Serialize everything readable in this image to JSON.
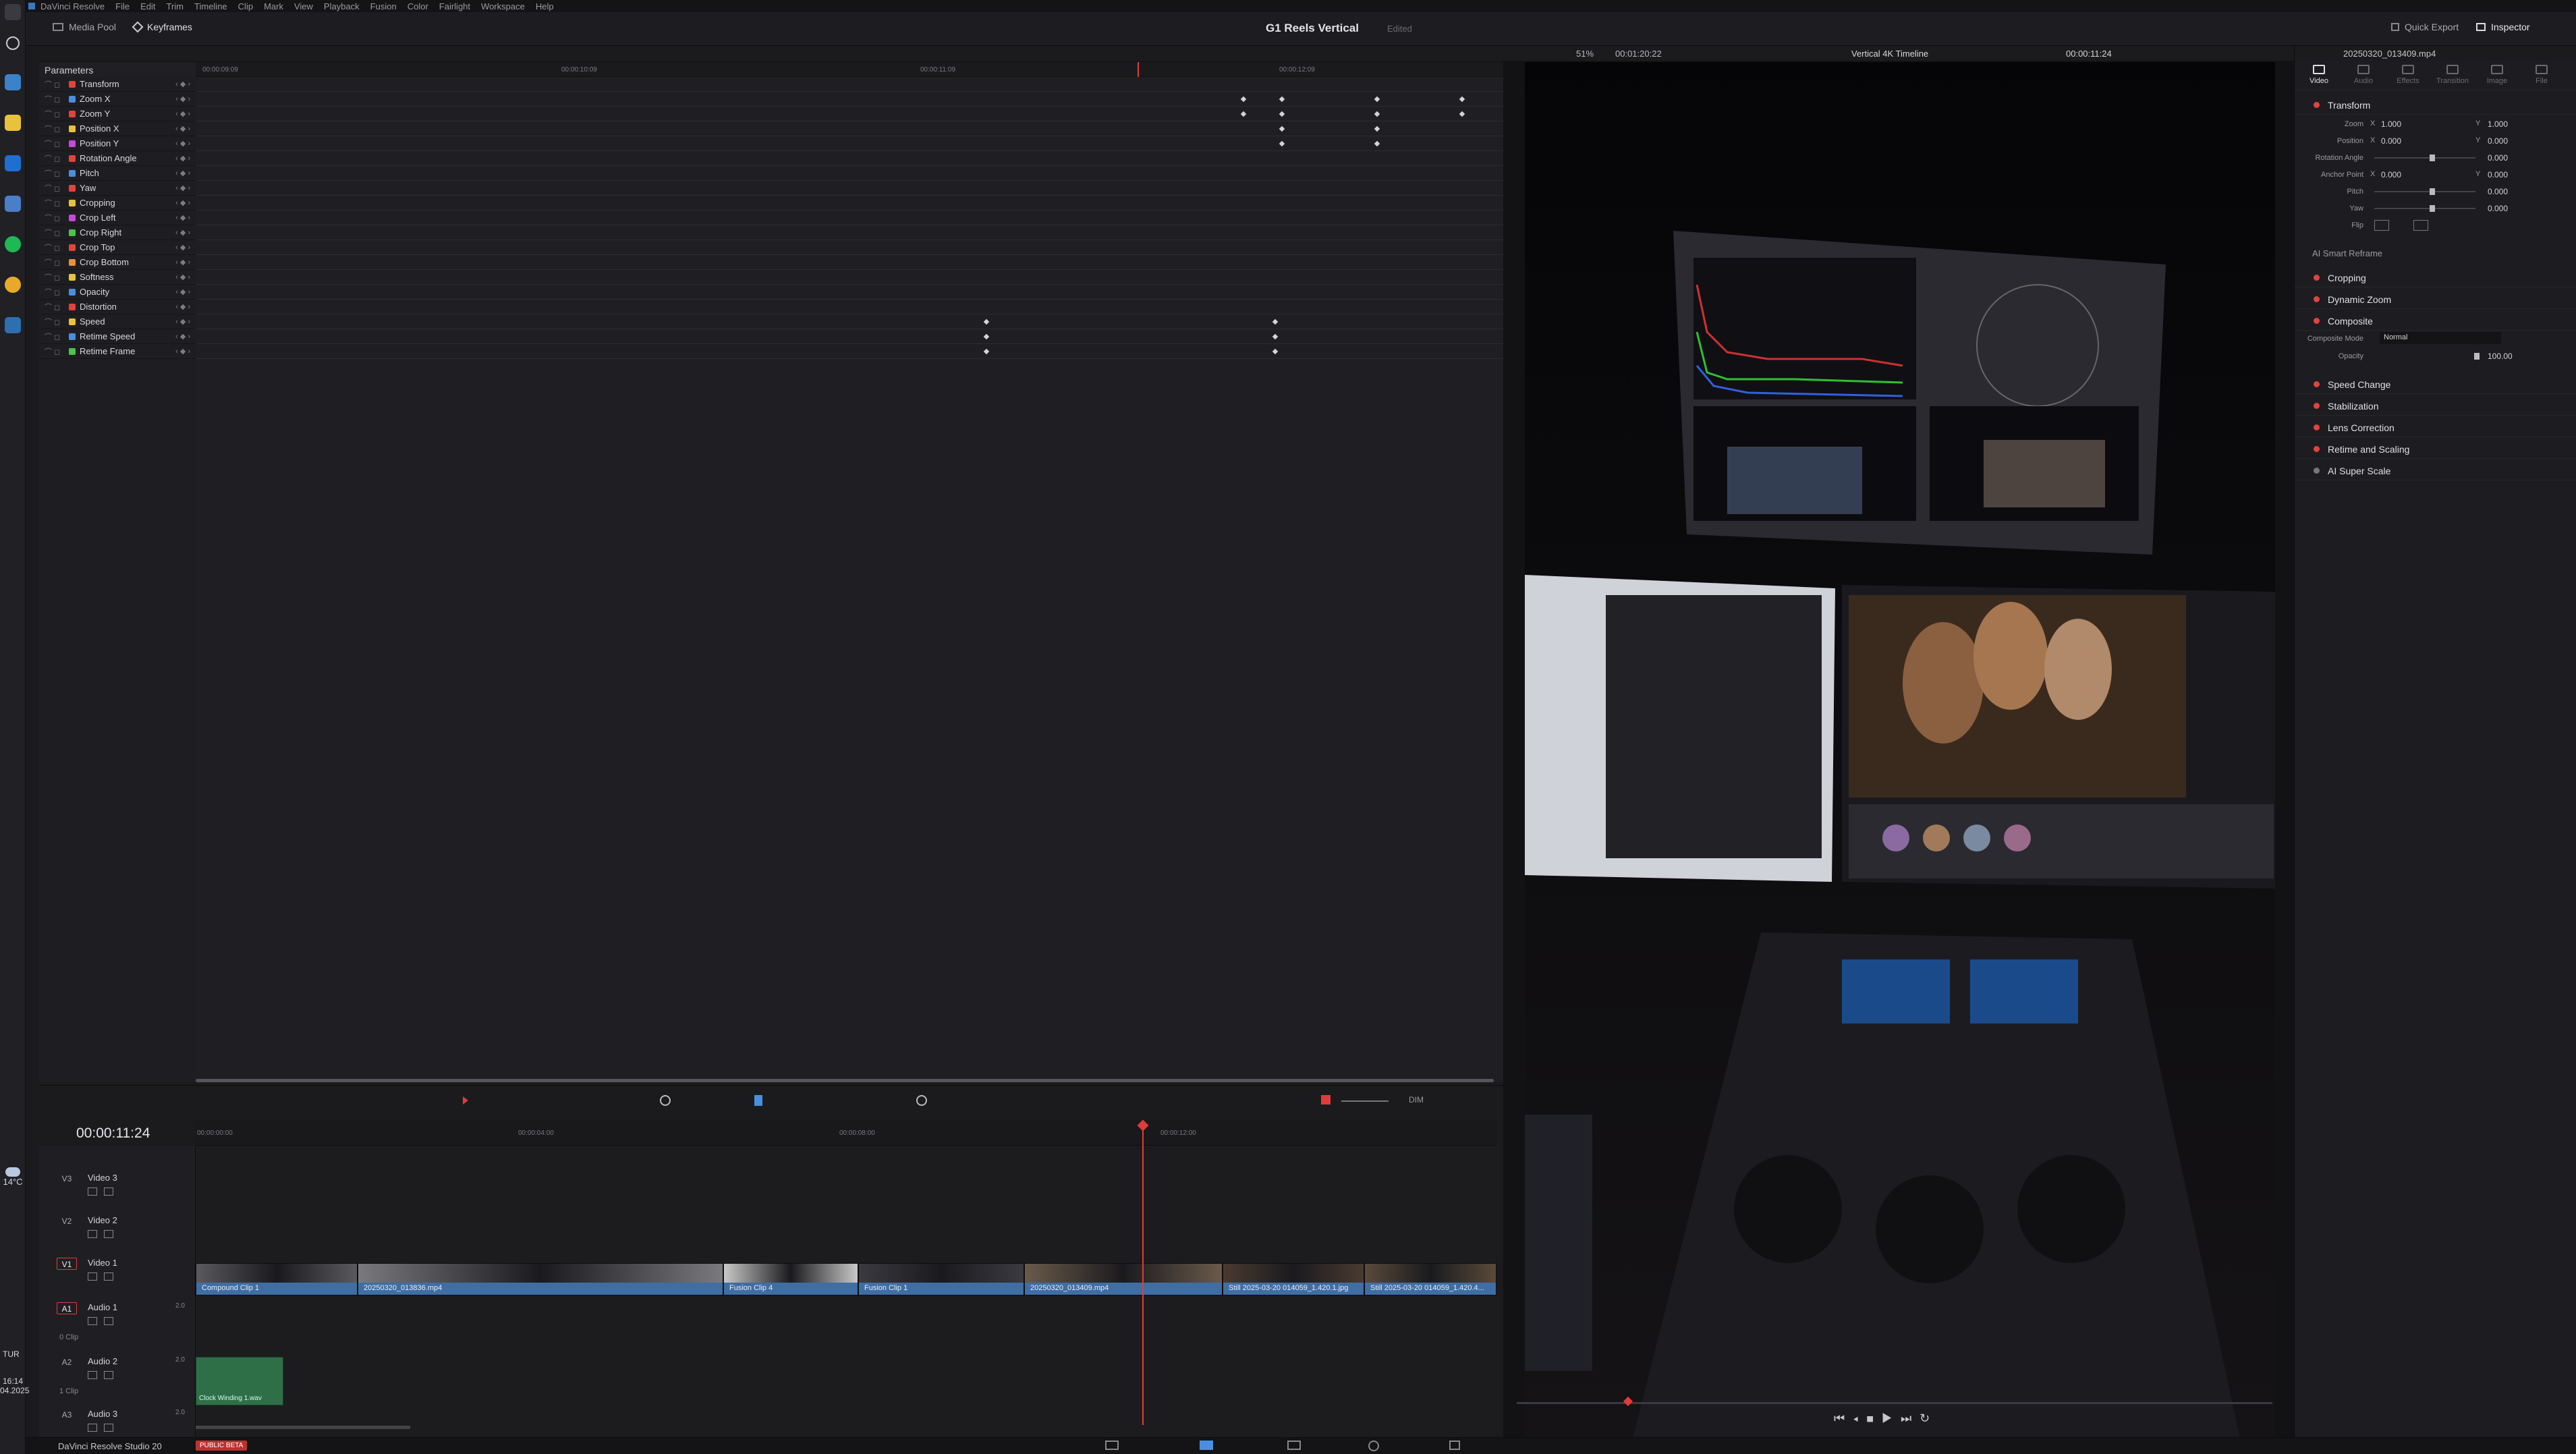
{
  "menu": [
    "DaVinci Resolve",
    "File",
    "Edit",
    "Trim",
    "Timeline",
    "Clip",
    "Mark",
    "View",
    "Playback",
    "Fusion",
    "Color",
    "Fairlight",
    "Workspace",
    "Help"
  ],
  "header": {
    "media_pool": "Media Pool",
    "keyframes": "Keyframes",
    "project_title": "G1 Reels Vertical",
    "edited": "Edited",
    "quick_export": "Quick Export",
    "inspector": "Inspector"
  },
  "keyframe_panel": {
    "title": "Parameters",
    "ruler": [
      "00:00:09:09",
      "00:00:10:09",
      "00:00:11:09",
      "00:00:12:09"
    ],
    "params": [
      {
        "label": "Transform",
        "color": "#e0443c"
      },
      {
        "label": "Zoom X",
        "color": "#4a8ee0"
      },
      {
        "label": "Zoom Y",
        "color": "#e0443c"
      },
      {
        "label": "Position X",
        "color": "#e8c23a"
      },
      {
        "label": "Position Y",
        "color": "#c44ad8"
      },
      {
        "label": "Rotation Angle",
        "color": "#e0443c"
      },
      {
        "label": "Pitch",
        "color": "#4a8ee0"
      },
      {
        "label": "Yaw",
        "color": "#e0443c"
      },
      {
        "label": "Cropping",
        "color": "#e8c23a"
      },
      {
        "label": "Crop Left",
        "color": "#c44ad8"
      },
      {
        "label": "Crop Right",
        "color": "#4ac44a"
      },
      {
        "label": "Crop Top",
        "color": "#e0443c"
      },
      {
        "label": "Crop Bottom",
        "color": "#e8913a"
      },
      {
        "label": "Softness",
        "color": "#e8c23a"
      },
      {
        "label": "Opacity",
        "color": "#4a8ee0"
      },
      {
        "label": "Distortion",
        "color": "#e0443c"
      },
      {
        "label": "Speed",
        "color": "#e8c23a"
      },
      {
        "label": "Retime Speed",
        "color": "#4a8ee0"
      },
      {
        "label": "Retime Frame",
        "color": "#4ac44a"
      }
    ]
  },
  "viewer": {
    "zoom": "51%",
    "timecode_left": "00:01:20:22",
    "timeline_name": "Vertical 4K Timeline",
    "timecode_right": "00:00:11:24"
  },
  "inspector": {
    "clip_name": "20250320_013409.mp4",
    "tabs": [
      "Video",
      "Audio",
      "Effects",
      "Transition",
      "Image",
      "File"
    ],
    "transform_title": "Transform",
    "params": [
      {
        "label": "Zoom",
        "x": "1.000",
        "y": "1.000"
      },
      {
        "label": "Position",
        "x": "0.000",
        "y": "0.000"
      },
      {
        "label": "Rotation Angle",
        "value": "0.000"
      },
      {
        "label": "Anchor Point",
        "x": "0.000",
        "y": "0.000"
      },
      {
        "label": "Pitch",
        "value": "0.000"
      },
      {
        "label": "Yaw",
        "value": "0.000"
      },
      {
        "label": "Flip"
      }
    ],
    "ai_smart_reframe": "AI Smart Reframe",
    "sections": [
      "Cropping",
      "Dynamic Zoom",
      "Composite",
      "Speed Change",
      "Stabilization",
      "Lens Correction",
      "Retime and Scaling",
      "AI Super Scale"
    ],
    "composite_mode_label": "Composite Mode",
    "composite_mode": "Normal",
    "opacity_label": "Opacity",
    "opacity": "100.00"
  },
  "timeline": {
    "timecode": "00:00:11:24",
    "ruler": [
      "00:00:00:00",
      "00:00:04:00",
      "00:00:08:00",
      "00:00:12:00"
    ],
    "tracks": [
      {
        "id": "V3",
        "name": "Video 3"
      },
      {
        "id": "V2",
        "name": "Video 2"
      },
      {
        "id": "V1",
        "name": "Video 1"
      },
      {
        "id": "A1",
        "name": "Audio 1",
        "ch": "2.0",
        "count": "0 Clip"
      },
      {
        "id": "A2",
        "name": "Audio 2",
        "ch": "2.0",
        "count": "1 Clip"
      },
      {
        "id": "A3",
        "name": "Audio 3",
        "ch": "2.0"
      }
    ],
    "clips": [
      {
        "label": "Compound Clip 1"
      },
      {
        "label": "20250320_013836.mp4"
      },
      {
        "label": "Fusion Clip 4"
      },
      {
        "label": "Fusion Clip 1"
      },
      {
        "label": "20250320_013409.mp4"
      },
      {
        "label": "Still 2025-03-20 014059_1.420.1.jpg"
      },
      {
        "label": "Still 2025-03-20 014059_1.420.4..."
      }
    ],
    "audio_clip": "Clock Winding 1.wav",
    "dim": "DIM"
  },
  "status": {
    "app": "DaVinci Resolve Studio 20",
    "badge": "PUBLIC BETA"
  },
  "system": {
    "temp": "14°C",
    "lang": "TUR",
    "time": "16:14",
    "date": "04.2025"
  }
}
